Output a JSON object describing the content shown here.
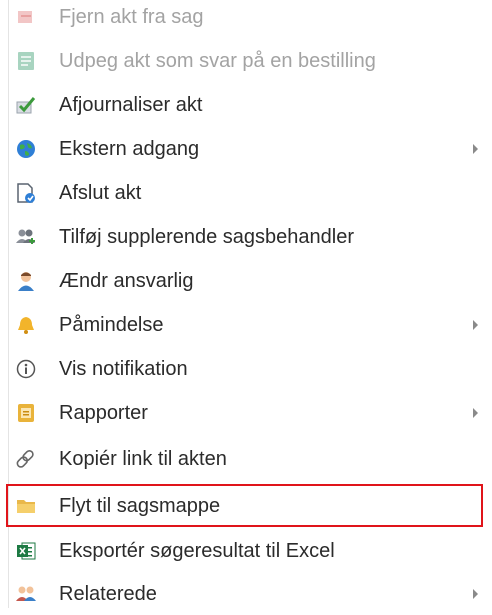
{
  "menu": {
    "items": [
      {
        "label": "Fjern akt fra sag",
        "icon": "remove-icon",
        "disabled": true
      },
      {
        "label": "Udpeg akt som svar på en bestilling",
        "icon": "answer-icon",
        "disabled": true
      },
      {
        "label": "Afjournaliser akt",
        "icon": "checkmark-doc-icon"
      },
      {
        "label": "Ekstern adgang",
        "icon": "globe-icon",
        "submenu": true
      },
      {
        "label": "Afslut akt",
        "icon": "finish-doc-icon"
      },
      {
        "label": "Tilføj supplerende sagsbehandler",
        "icon": "add-users-icon"
      },
      {
        "label": "Ændr ansvarlig",
        "icon": "user-icon"
      },
      {
        "label": "Påmindelse",
        "icon": "bell-icon",
        "submenu": true
      },
      {
        "label": "Vis notifikation",
        "icon": "info-icon"
      },
      {
        "label": "Rapporter",
        "icon": "report-icon",
        "submenu": true
      },
      {
        "label": "Kopiér link til akten",
        "icon": "link-icon"
      },
      {
        "label": "Flyt til sagsmappe",
        "icon": "folder-icon",
        "highlighted": true
      },
      {
        "label": "Eksportér søgeresultat til Excel",
        "icon": "excel-icon"
      },
      {
        "label": "Relaterede",
        "icon": "related-users-icon",
        "submenu": true
      }
    ]
  },
  "colors": {
    "highlight_border": "#e0141a",
    "disabled_text": "#a3a3a3",
    "text": "#2b2b2b"
  }
}
